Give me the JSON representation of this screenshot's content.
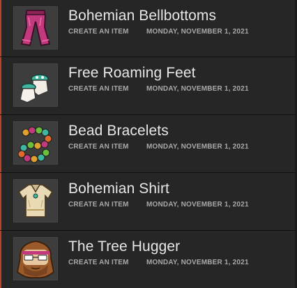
{
  "items": [
    {
      "title": "Bohemian Bellbottoms",
      "type": "CREATE AN ITEM",
      "date": "MONDAY, NOVEMBER 1, 2021",
      "icon": "pants-icon"
    },
    {
      "title": "Free Roaming Feet",
      "type": "CREATE AN ITEM",
      "date": "MONDAY, NOVEMBER 1, 2021",
      "icon": "feet-icon"
    },
    {
      "title": "Bead Bracelets",
      "type": "CREATE AN ITEM",
      "date": "MONDAY, NOVEMBER 1, 2021",
      "icon": "bracelets-icon"
    },
    {
      "title": "Bohemian Shirt",
      "type": "CREATE AN ITEM",
      "date": "MONDAY, NOVEMBER 1, 2021",
      "icon": "shirt-icon"
    },
    {
      "title": "The Tree Hugger",
      "type": "CREATE AN ITEM",
      "date": "MONDAY, NOVEMBER 1, 2021",
      "icon": "hippie-face-icon"
    }
  ],
  "colors": {
    "background": "#262626",
    "accent": "#b8452a",
    "title_text": "#e7e7e7",
    "meta_text": "#a9a9a9"
  }
}
